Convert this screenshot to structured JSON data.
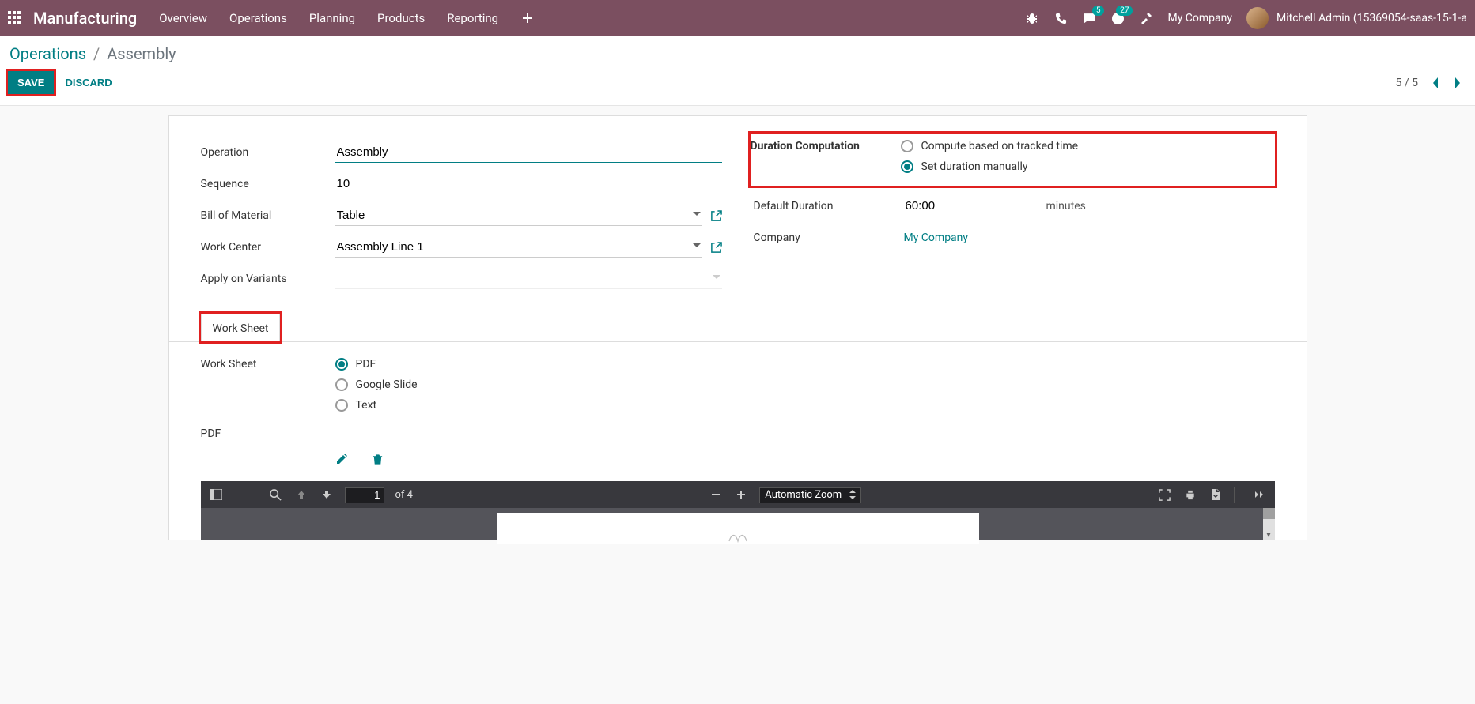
{
  "topbar": {
    "brand": "Manufacturing",
    "menu": [
      "Overview",
      "Operations",
      "Planning",
      "Products",
      "Reporting"
    ],
    "chat_badge": "5",
    "activity_badge": "27",
    "company": "My Company",
    "user": "Mitchell Admin (15369054-saas-15-1-a"
  },
  "breadcrumb": {
    "parent": "Operations",
    "current": "Assembly"
  },
  "actions": {
    "save": "SAVE",
    "discard": "DISCARD"
  },
  "pager": {
    "text": "5 / 5"
  },
  "form": {
    "left": {
      "operation_label": "Operation",
      "operation_value": "Assembly",
      "sequence_label": "Sequence",
      "sequence_value": "10",
      "bom_label": "Bill of Material",
      "bom_value": "Table",
      "workcenter_label": "Work Center",
      "workcenter_value": "Assembly Line 1",
      "variants_label": "Apply on Variants",
      "variants_value": ""
    },
    "right": {
      "duration_comp_label": "Duration Computation",
      "duration_opt1": "Compute based on tracked time",
      "duration_opt2": "Set duration manually",
      "default_duration_label": "Default Duration",
      "default_duration_value": "60:00",
      "default_duration_unit": "minutes",
      "company_label": "Company",
      "company_value": "My Company"
    }
  },
  "tabs": {
    "worksheet": "Work Sheet"
  },
  "worksheet": {
    "label": "Work Sheet",
    "options": {
      "pdf": "PDF",
      "google": "Google Slide",
      "text": "Text"
    },
    "pdf_label": "PDF"
  },
  "pdfviewer": {
    "page_value": "1",
    "page_of": "of 4",
    "zoom": "Automatic Zoom"
  }
}
